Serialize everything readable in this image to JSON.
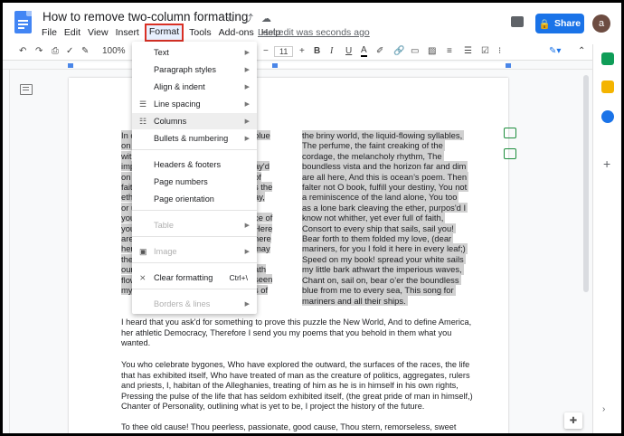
{
  "doc": {
    "title": "How to remove two-column formatting",
    "last_edit": "Last edit was seconds ago"
  },
  "menubar": [
    "File",
    "Edit",
    "View",
    "Insert",
    "Format",
    "Tools",
    "Add-ons",
    "Help"
  ],
  "header": {
    "share_label": "Share",
    "avatar_letter": "a",
    "star_icon": "☆",
    "move_icon": "⤴",
    "cloud_icon": "☁"
  },
  "toolbar": {
    "zoom": "100%",
    "font_size": "11",
    "bold": "B",
    "italic": "I",
    "underline": "U",
    "text_color": "A"
  },
  "format_menu": {
    "items": [
      {
        "label": "Text",
        "arrow": "▶"
      },
      {
        "label": "Paragraph styles",
        "arrow": "▶"
      },
      {
        "label": "Align & indent",
        "arrow": "▶"
      },
      {
        "label": "Line spacing",
        "arrow": "▶",
        "icon": "☰"
      },
      {
        "label": "Columns",
        "arrow": "▶",
        "icon": "☷"
      },
      {
        "label": "Bullets & numbering",
        "arrow": "▶"
      },
      {
        "label": "Headers & footers"
      },
      {
        "label": "Page numbers"
      },
      {
        "label": "Page orientation"
      },
      {
        "label": "Table",
        "arrow": "▶"
      },
      {
        "label": "Image",
        "arrow": "▶",
        "icon": "▣"
      },
      {
        "label": "Clear formatting",
        "shortcut": "Ctrl+\\",
        "icon": "⨯"
      },
      {
        "label": "Borders & lines",
        "arrow": "▶"
      }
    ]
  },
  "columns": {
    "left": [
      "In c",
      "on c",
      "wit",
      "imp",
      "on s",
      "faitl",
      "ethe",
      "or u",
      "you",
      "you",
      "are",
      "her",
      "the",
      "our",
      "flow",
      "mys"
    ],
    "left_right_fragments": [
      "blue",
      "",
      "",
      "ay'd",
      "of",
      "s the",
      "ay,",
      "",
      "ce of",
      "Here",
      "here",
      "may",
      "",
      "ath",
      "seen",
      "s of"
    ],
    "right": [
      "the briny world, the liquid-flowing syllables,",
      "The perfume, the faint creaking of the",
      "cordage, the melancholy rhythm, The",
      "boundless vista and the horizon far and dim",
      "are all here, And this is ocean’s poem. Then",
      "falter not O book, fulfill your destiny, You not",
      "a reminiscence of the land alone, You too",
      "as a lone bark cleaving the ether, purpos'd I",
      "know not whither, yet ever full of faith,",
      "Consort to every ship that sails, sail you!",
      "Bear forth to them folded my love, (dear",
      "mariners, for you I fold it here in every leaf;)",
      "Speed on my book! spread your white sails",
      "my little bark athwart the imperious waves,",
      "Chant on, sail on, bear o’er the boundless",
      "blue from me to every sea, This song for",
      "mariners and all their ships."
    ]
  },
  "paragraphs": [
    "I heard that you ask'd for something to prove this puzzle the New World, And to define America,\nher athletic Democracy, Therefore I send you my poems that you behold in them what you\nwanted.",
    "You who celebrate bygones, Who have explored the outward, the surfaces of the races, the life\nthat has exhibited itself, Who have treated of man as the creature of politics, aggregates, rulers\nand priests, I, habitan of the Alleghanies, treating of him as he is in himself in his own rights,\nPressing the pulse of the life that has seldom exhibited itself, (the great pride of man in himself,)\nChanter of Personality, outlining what is yet to be, I project the history of the future.",
    "To thee old cause! Thou peerless, passionate, good cause, Thou stern, remorseless, sweet"
  ],
  "colors": {
    "accent": "#1a73e8",
    "highlight_box": "#d93025",
    "selection": "#d0d0d0"
  }
}
